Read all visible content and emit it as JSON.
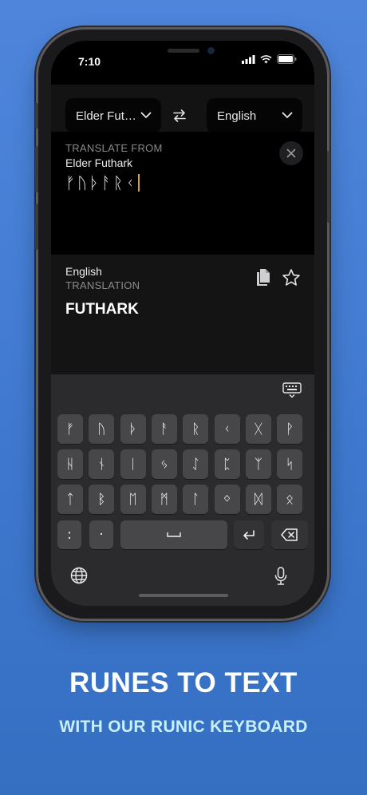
{
  "status_bar": {
    "time": "7:10"
  },
  "language_bar": {
    "source_language": "Elder Fut…",
    "target_language": "English"
  },
  "source_panel": {
    "caption": "TRANSLATE FROM",
    "language": "Elder Futhark",
    "input_text": "ᚠᚢᚦᚨᚱᚲ"
  },
  "target_panel": {
    "language": "English",
    "caption": "TRANSLATION",
    "output_text": "FUTHARK"
  },
  "keyboard": {
    "rows": [
      [
        "ᚠ",
        "ᚢ",
        "ᚦ",
        "ᚨ",
        "ᚱ",
        "ᚲ",
        "ᚷ",
        "ᚹ"
      ],
      [
        "ᚺ",
        "ᚾ",
        "ᛁ",
        "ᛃ",
        "ᛇ",
        "ᛈ",
        "ᛉ",
        "ᛋ"
      ],
      [
        "ᛏ",
        "ᛒ",
        "ᛖ",
        "ᛗ",
        "ᛚ",
        "ᛜ",
        "ᛞ",
        "ᛟ"
      ]
    ],
    "colon": ":",
    "dot": "·",
    "space": "␣",
    "return": "↵"
  },
  "promo": {
    "headline": "RUNES TO TEXT",
    "subline": "WITH OUR RUNIC KEYBOARD"
  },
  "icons": {
    "swap": "swap-arrows-icon",
    "clear": "close-icon",
    "copy": "copy-icon",
    "favorite": "star-icon",
    "keyboard_dismiss": "keyboard-icon",
    "globe": "globe-icon",
    "mic": "microphone-icon",
    "delete": "delete-backward-icon"
  },
  "colors": {
    "background": "#4a82d8",
    "cursor": "#d9a23a",
    "subline": "#c8f0ff"
  }
}
